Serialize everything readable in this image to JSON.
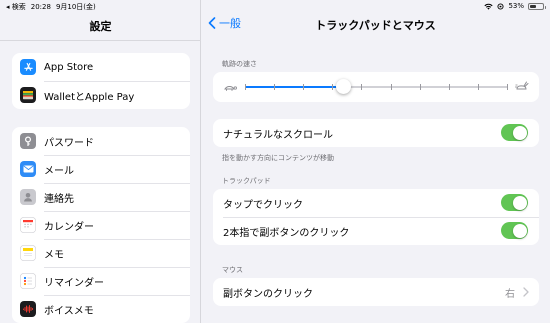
{
  "status_bar": {
    "back_app": "◂ 検索",
    "time": "20:28",
    "date": "9月10日(金)",
    "battery_text": "53%",
    "battery_level": 0.53
  },
  "sidebar": {
    "title": "設定",
    "group1": [
      {
        "label": "App Store",
        "icon": "app-store-icon",
        "color": "#1a8cff"
      },
      {
        "label": "WalletとApple Pay",
        "icon": "wallet-icon",
        "color": "#1c1c1e"
      }
    ],
    "group2": [
      {
        "label": "パスワード",
        "icon": "key-icon",
        "color": "#8e8e93"
      },
      {
        "label": "メール",
        "icon": "mail-icon",
        "color": "#2f8cf6"
      },
      {
        "label": "連絡先",
        "icon": "contacts-icon",
        "color": "#b4b4b9"
      },
      {
        "label": "カレンダー",
        "icon": "calendar-icon",
        "color": "#ffffff"
      },
      {
        "label": "メモ",
        "icon": "notes-icon",
        "color": "#ffffff"
      },
      {
        "label": "リマインダー",
        "icon": "reminders-icon",
        "color": "#ffffff"
      },
      {
        "label": "ボイスメモ",
        "icon": "voice-memos-icon",
        "color": "#1c1c1e"
      }
    ]
  },
  "detail": {
    "back_label": "一般",
    "title": "トラックパッドとマウス",
    "tracking_header": "軌跡の速さ",
    "tracking_speed_ticks": 10,
    "tracking_speed_value": 0.375,
    "natural_scroll_label": "ナチュラルなスクロール",
    "natural_scroll_on": true,
    "natural_scroll_footnote": "指を動かす方向にコンテンツが移動",
    "trackpad_header": "トラックパッド",
    "tap_to_click_label": "タップでクリック",
    "tap_to_click_on": true,
    "two_finger_label": "2本指で副ボタンのクリック",
    "two_finger_on": true,
    "mouse_header": "マウス",
    "secondary_click_label": "副ボタンのクリック",
    "secondary_click_value": "右"
  },
  "colors": {
    "accent": "#0a7aff",
    "toggle_on": "#61c554",
    "background": "#f2f2f7"
  }
}
